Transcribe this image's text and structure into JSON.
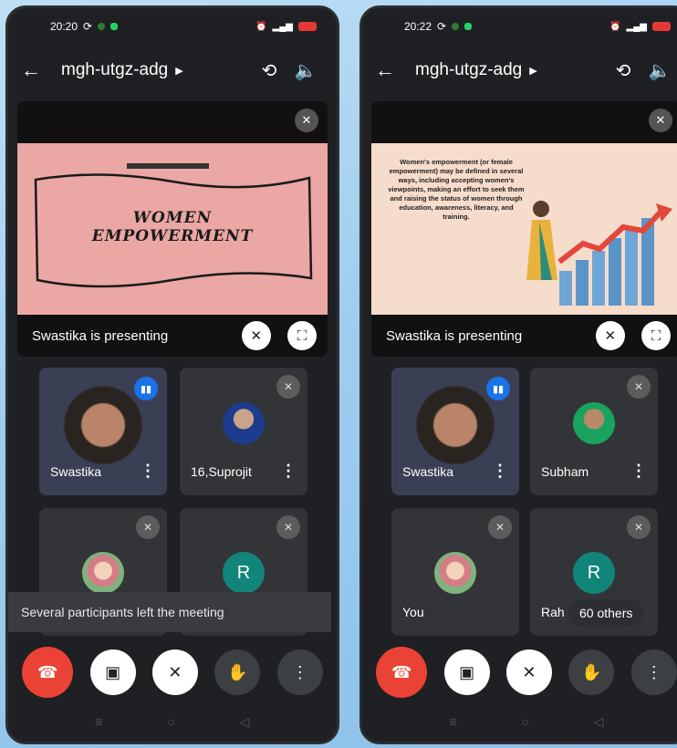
{
  "colors": {
    "end_call": "#ea4335",
    "speaking": "#1a73e8",
    "avatar_letter_bg": "#12857a"
  },
  "left": {
    "status": {
      "time": "20:20"
    },
    "header": {
      "meeting_code": "mgh-utgz-adg"
    },
    "presentation": {
      "presenter_text": "Swastika is presenting",
      "slide_title_line1": "WOMEN",
      "slide_title_line2": "EMPOWERMENT"
    },
    "tiles": [
      {
        "name": "Swastika",
        "state": "speaking"
      },
      {
        "name": "16,Suprojit",
        "state": "muted"
      },
      {
        "name": "",
        "state": "muted"
      },
      {
        "name": "",
        "state": "muted",
        "avatar_letter": "R"
      }
    ],
    "toast": "Several participants left the meeting"
  },
  "right": {
    "status": {
      "time": "20:22"
    },
    "header": {
      "meeting_code": "mgh-utgz-adg"
    },
    "presentation": {
      "presenter_text": "Swastika is presenting",
      "slide_body": "Women's empowerment (or female empowerment) may be defined in several ways, including accepting women's viewpoints, making an effort to seek them and raising the status of women through education, awareness, literacy, and training."
    },
    "tiles": [
      {
        "name": "Swastika",
        "state": "speaking"
      },
      {
        "name": "Subham",
        "state": "muted"
      },
      {
        "name": "You",
        "state": "muted"
      },
      {
        "name": "Rah",
        "state": "muted",
        "avatar_letter": "R"
      }
    ],
    "others_chip": "60 others"
  },
  "icons": {
    "back": "arrow-left-icon",
    "camera_switch": "camera-switch-icon",
    "speaker": "speaker-icon",
    "mic_off": "mic-off-icon",
    "fullscreen": "fullscreen-icon",
    "end_call": "phone-end-icon",
    "camera_off": "camera-off-icon",
    "raise_hand": "hand-icon",
    "more": "more-vert-icon"
  }
}
